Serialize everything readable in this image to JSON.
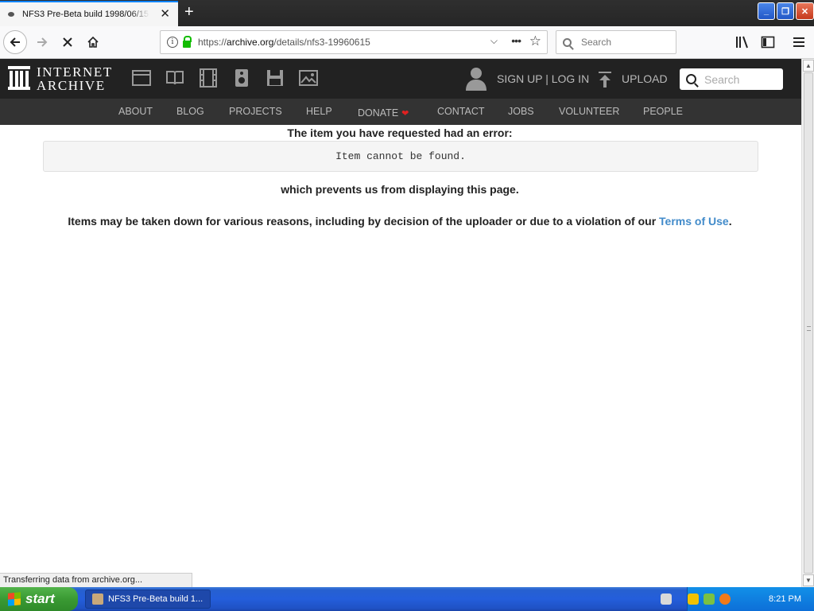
{
  "browser": {
    "tab_title": "NFS3 Pre-Beta build 1998/06/15 :",
    "url_scheme": "https://",
    "url_host": "archive.org",
    "url_path": "/details/nfs3-19960615",
    "search_placeholder": "Search"
  },
  "ia": {
    "logo_line1": "INTERNET",
    "logo_line2": "ARCHIVE",
    "signup_label": "SIGN UP | LOG IN",
    "upload_label": "UPLOAD",
    "search_placeholder": "Search",
    "media_icons": [
      "web-icon",
      "texts-icon",
      "video-icon",
      "audio-icon",
      "software-icon",
      "images-icon"
    ],
    "nav": [
      {
        "label": "ABOUT"
      },
      {
        "label": "BLOG"
      },
      {
        "label": "PROJECTS"
      },
      {
        "label": "HELP"
      },
      {
        "label": "DONATE"
      },
      {
        "label": "CONTACT"
      },
      {
        "label": "JOBS"
      },
      {
        "label": "VOLUNTEER"
      },
      {
        "label": "PEOPLE"
      }
    ]
  },
  "content": {
    "error_heading": "The item you have requested had an error:",
    "error_message": "Item cannot be found.",
    "prevents_text": "which prevents us from displaying this page.",
    "reason_text": "Items may be taken down for various reasons, including by decision of the uploader or due to a violation of our",
    "terms_link": "Terms of Use",
    "reason_end": "."
  },
  "status": {
    "text": "Transferring data from archive.org..."
  },
  "taskbar": {
    "start_label": "start",
    "task_item": "NFS3 Pre-Beta build 1...",
    "clock": "8:21 PM"
  },
  "colors": {
    "ia_header": "#222222",
    "ia_nav": "#333333",
    "link": "#428bca",
    "taskbar": "#245edb",
    "start_button": "#3a9a33"
  }
}
